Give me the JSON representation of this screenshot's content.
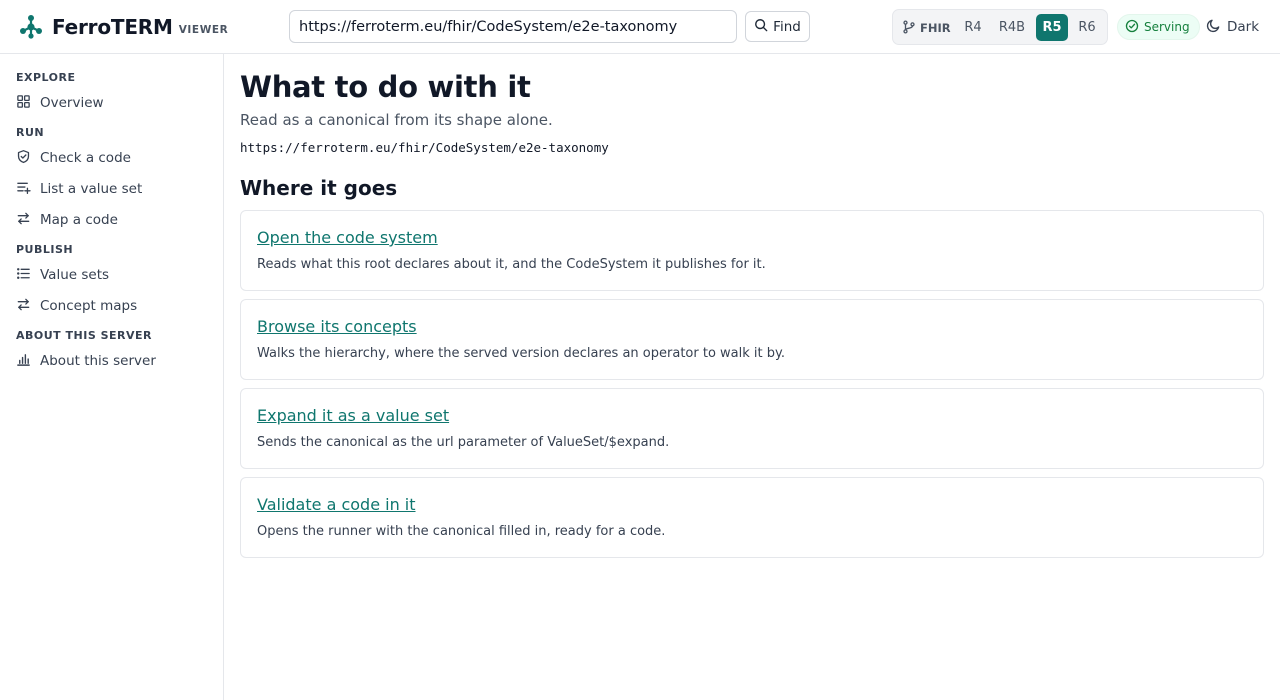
{
  "header": {
    "brand_name": "FerroTERM",
    "brand_sub": "VIEWER",
    "url_value": "https://ferroterm.eu/fhir/CodeSystem/e2e-taxonomy",
    "find_label": "Find",
    "fhir_label": "FHIR",
    "versions": [
      "R4",
      "R4B",
      "R5",
      "R6"
    ],
    "active_version": "R5",
    "status_label": "Serving",
    "theme_label": "Dark",
    "accent_color": "#0f766e"
  },
  "sidebar": {
    "sections": [
      {
        "heading": "EXPLORE",
        "items": [
          {
            "label": "Overview",
            "icon": "grid-icon"
          }
        ]
      },
      {
        "heading": "RUN",
        "items": [
          {
            "label": "Check a code",
            "icon": "shield-check-icon"
          },
          {
            "label": "List a value set",
            "icon": "list-plus-icon"
          },
          {
            "label": "Map a code",
            "icon": "arrows-exchange-icon"
          }
        ]
      },
      {
        "heading": "PUBLISH",
        "items": [
          {
            "label": "Value sets",
            "icon": "list-icon"
          },
          {
            "label": "Concept maps",
            "icon": "arrows-exchange-icon"
          }
        ]
      },
      {
        "heading": "ABOUT THIS SERVER",
        "items": [
          {
            "label": "About this server",
            "icon": "bar-chart-icon"
          }
        ]
      }
    ]
  },
  "main": {
    "title": "What to do with it",
    "subtitle": "Read as a canonical from its shape alone.",
    "canonical": "https://ferroterm.eu/fhir/CodeSystem/e2e-taxonomy",
    "section_title": "Where it goes",
    "cards": [
      {
        "link": "Open the code system",
        "description": "Reads what this root declares about it, and the CodeSystem it publishes for it."
      },
      {
        "link": "Browse its concepts",
        "description": "Walks the hierarchy, where the served version declares an operator to walk it by."
      },
      {
        "link": "Expand it as a value set",
        "description": "Sends the canonical as the url parameter of ValueSet/$expand."
      },
      {
        "link": "Validate a code in it",
        "description": "Opens the runner with the canonical filled in, ready for a code."
      }
    ]
  }
}
